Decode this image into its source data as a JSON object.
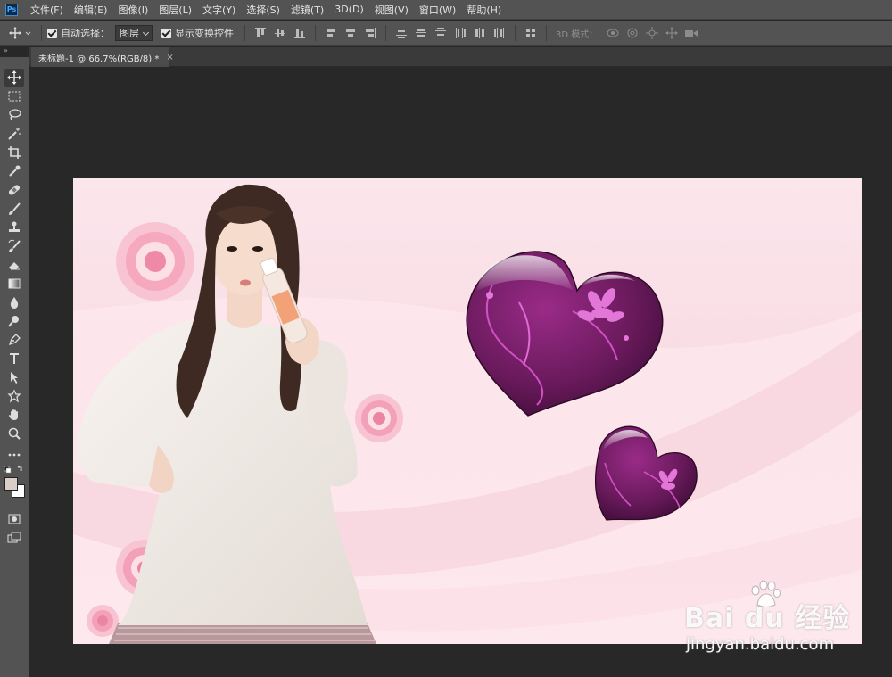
{
  "app": {
    "logo": "Ps"
  },
  "menu": [
    "文件(F)",
    "编辑(E)",
    "图像(I)",
    "图层(L)",
    "文字(Y)",
    "选择(S)",
    "滤镜(T)",
    "3D(D)",
    "视图(V)",
    "窗口(W)",
    "帮助(H)"
  ],
  "options": {
    "auto_select_label": "自动选择：",
    "auto_select_checked": true,
    "layer_select_value": "图层",
    "show_transform_label": "显示变换控件",
    "show_transform_checked": true,
    "mode_3d_label": "3D 模式："
  },
  "document": {
    "tab_title": "未标题-1 @ 66.7%(RGB/8) *",
    "close_glyph": "×"
  },
  "tools": [
    "move-tool",
    "marquee-tool",
    "lasso-tool",
    "magic-wand-tool",
    "crop-tool",
    "eyedropper-tool",
    "healing-brush-tool",
    "brush-tool",
    "clone-stamp-tool",
    "history-brush-tool",
    "eraser-tool",
    "gradient-tool",
    "blur-tool",
    "dodge-tool",
    "pen-tool",
    "type-tool",
    "path-selection-tool",
    "shape-tool",
    "hand-tool",
    "zoom-tool",
    "more-tools"
  ],
  "colors": {
    "foreground": "#d9cfc8",
    "background": "#ffffff",
    "heart_purple": "#6a1a5c",
    "heart_pink_pattern": "#d24fc4",
    "canvas_pink": "#f9dbe3"
  },
  "watermark": {
    "logo_text": "Bai  du 经验",
    "url": "jingyan.baidu.com"
  }
}
